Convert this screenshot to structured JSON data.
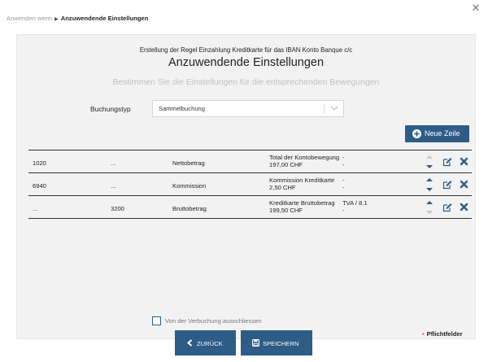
{
  "breadcrumb": {
    "step1": "Anwenden wenn",
    "step2": "Anzuwendende Einstellungen"
  },
  "header": {
    "rule_title": "Erstellung der Regel Einzahlung Kreditkarte für das IBAN Konto Banque c/c",
    "title": "Anzuwendende Einstellungen",
    "subtitle": "Bestimmen Sie die Einstellungen für die entsprechenden Bewegungen"
  },
  "buchungstyp": {
    "label": "Buchungstyp",
    "value": "Sammelbuchung"
  },
  "new_row_button": {
    "label": "Neue Zeile"
  },
  "rows": [
    {
      "account": "1020",
      "counter": "...",
      "type": "Nettobetrag",
      "desc_line1": "Total der Kontobewegung",
      "desc_line2": "197,00 CHF",
      "vat_line1": "-",
      "vat_line2": "-",
      "up_active": false,
      "down_active": true
    },
    {
      "account": "6940",
      "counter": "...",
      "type": "Kommission",
      "desc_line1": "Kommission Kreditkarte",
      "desc_line2": "2,50 CHF",
      "vat_line1": "-",
      "vat_line2": "-",
      "up_active": true,
      "down_active": true
    },
    {
      "account": "...",
      "counter": "3200",
      "type": "Bruttobetrag",
      "desc_line1": "Kreditkarte Bruttobetrag",
      "desc_line2": "199,50 CHF",
      "vat_line1": "TVA / 8.1",
      "vat_line2": "-",
      "up_active": true,
      "down_active": false
    }
  ],
  "exclude_checkbox": {
    "label": "Von der Verbuchung ausschliessen",
    "checked": false
  },
  "buttons": {
    "back": "ZURÜCK",
    "save": "SPEICHERN"
  },
  "required_note": "Pflichtfelder",
  "colors": {
    "primary": "#2d5c87",
    "panel": "#f2f2f2",
    "danger": "#d9534f",
    "muted": "#c2c2c2"
  }
}
